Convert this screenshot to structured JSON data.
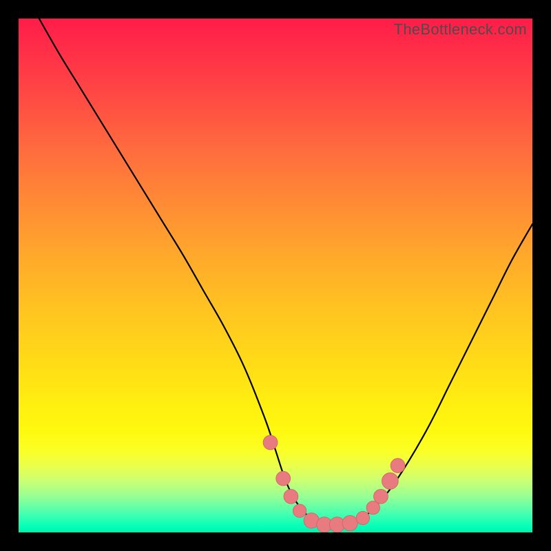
{
  "watermark": "TheBottleneck.com",
  "colors": {
    "background": "#000000",
    "curve": "#000000",
    "marker_fill": "#e77b7f",
    "marker_stroke": "#d65e63"
  },
  "chart_data": {
    "type": "line",
    "title": "",
    "xlabel": "",
    "ylabel": "",
    "xlim": [
      0,
      100
    ],
    "ylim": [
      0,
      100
    ],
    "grid": false,
    "legend": false,
    "annotations": [],
    "series": [
      {
        "name": "bottleneck-curve",
        "x": [
          4,
          8,
          12,
          16,
          20,
          24,
          28,
          32,
          36,
          40,
          44,
          48,
          50,
          52,
          54,
          56,
          58,
          60,
          62,
          64,
          66,
          68,
          72,
          76,
          80,
          84,
          88,
          92,
          96,
          100
        ],
        "y": [
          100,
          93,
          86.5,
          80,
          73.5,
          67,
          60.5,
          54,
          47,
          40,
          32,
          22,
          16,
          10,
          6,
          3.5,
          2,
          1.5,
          1.5,
          1.7,
          2.2,
          3.6,
          8,
          14,
          21,
          29,
          37,
          45,
          53,
          60
        ]
      }
    ],
    "markers": [
      {
        "x": 49.0,
        "y": 17.5,
        "r": 1.4
      },
      {
        "x": 51.5,
        "y": 10.5,
        "r": 1.4
      },
      {
        "x": 53.0,
        "y": 7.0,
        "r": 1.4
      },
      {
        "x": 54.7,
        "y": 4.2,
        "r": 1.3
      },
      {
        "x": 57.0,
        "y": 2.3,
        "r": 1.5
      },
      {
        "x": 59.5,
        "y": 1.5,
        "r": 1.5
      },
      {
        "x": 62.0,
        "y": 1.5,
        "r": 1.5
      },
      {
        "x": 64.5,
        "y": 1.8,
        "r": 1.5
      },
      {
        "x": 67.0,
        "y": 2.8,
        "r": 1.3
      },
      {
        "x": 69.0,
        "y": 4.8,
        "r": 1.3
      },
      {
        "x": 70.5,
        "y": 7.0,
        "r": 1.4
      },
      {
        "x": 72.3,
        "y": 10.0,
        "r": 1.6
      },
      {
        "x": 73.8,
        "y": 13.0,
        "r": 1.4
      }
    ]
  }
}
